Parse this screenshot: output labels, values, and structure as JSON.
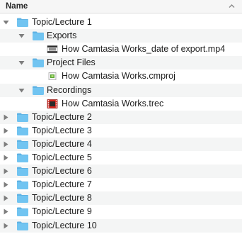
{
  "header": {
    "name_label": "Name",
    "sort_icon": "chevron-up-icon"
  },
  "rows": [
    {
      "label": "Topic/Lecture 1",
      "level": 0,
      "kind": "folder",
      "expanded": true
    },
    {
      "label": "Exports",
      "level": 1,
      "kind": "folder",
      "expanded": true
    },
    {
      "label": "How Camtasia Works_date of export.mp4",
      "level": 2,
      "kind": "video-file"
    },
    {
      "label": "Project Files",
      "level": 1,
      "kind": "folder",
      "expanded": true
    },
    {
      "label": "How Camtasia Works.cmproj",
      "level": 2,
      "kind": "project-file"
    },
    {
      "label": "Recordings",
      "level": 1,
      "kind": "folder",
      "expanded": true
    },
    {
      "label": "How Camtasia Works.trec",
      "level": 2,
      "kind": "recording-file"
    },
    {
      "label": "Topic/Lecture 2",
      "level": 0,
      "kind": "folder",
      "expanded": false
    },
    {
      "label": "Topic/Lecture 3",
      "level": 0,
      "kind": "folder",
      "expanded": false
    },
    {
      "label": "Topic/Lecture 4",
      "level": 0,
      "kind": "folder",
      "expanded": false
    },
    {
      "label": "Topic/Lecture 5",
      "level": 0,
      "kind": "folder",
      "expanded": false
    },
    {
      "label": "Topic/Lecture 6",
      "level": 0,
      "kind": "folder",
      "expanded": false
    },
    {
      "label": "Topic/Lecture 7",
      "level": 0,
      "kind": "folder",
      "expanded": false
    },
    {
      "label": "Topic/Lecture 8",
      "level": 0,
      "kind": "folder",
      "expanded": false
    },
    {
      "label": "Topic/Lecture 9",
      "level": 0,
      "kind": "folder",
      "expanded": false
    },
    {
      "label": "Topic/Lecture 10",
      "level": 0,
      "kind": "folder",
      "expanded": false
    }
  ],
  "colors": {
    "folder_fill": "#71c4f1",
    "folder_tab": "#5fb3e4",
    "disclosure": "#7d7d7d",
    "stripe": "#f4f5f5"
  }
}
